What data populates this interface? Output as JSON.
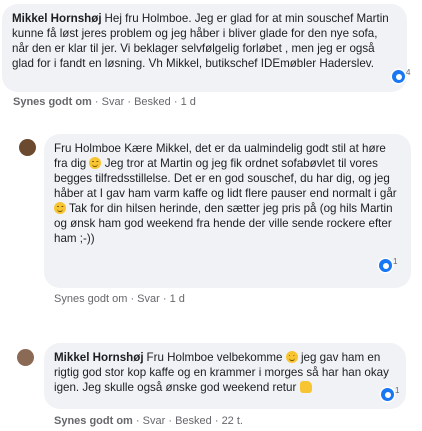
{
  "comments": [
    {
      "author": "Mikkel Hornshøj",
      "text": "Hej fru Holmboe. Jeg er glad for at min souschef Martin kunne få løst jeres problem og jeg håber i bliver glade for den nye sofa, når den er klar til jer. Vi beklager selvfølgelig forløbet , men jeg er også glad for i fandt en løsning. Vh Mikkel, butikschef IDEmøbler Haderslev.",
      "like": "Synes godt om",
      "reply": "Svar",
      "status": "Besked",
      "time": "1 d",
      "reactions": "4"
    },
    {
      "author": "Fru Holmboe",
      "text_a": "Kære Mikkel, det er da ualmindelig godt stil at høre fra dig",
      "text_b": "Jeg tror at Martin og jeg fik ordnet sofabøvlet til vores begges tilfredsstillelse. Det er en god souschef, du har dig, og jeg håber at I gav ham varm kaffe og lidt flere pauser end normalt i går",
      "text_c": "Tak for din hilsen herinde, den sætter jeg pris på (og hils Martin og ønsk ham god weekend fra hende der ville sende rockere efter ham ;-))",
      "like": "Synes godt om",
      "reply": "Svar",
      "time": "1 d",
      "reactions": "1"
    },
    {
      "author": "Mikkel Hornshøj",
      "text_a": "Fru Holmboe velbekomme",
      "text_b": "jeg gav ham en rigtig god stor kop kaffe og en krammer i morges så har han okay igen. Jeg skulle også ønske god weekend retur",
      "like": "Synes godt om",
      "reply": "Svar",
      "status": "Besked",
      "time": "22 t.",
      "reactions": "1"
    }
  ],
  "sep": "·"
}
